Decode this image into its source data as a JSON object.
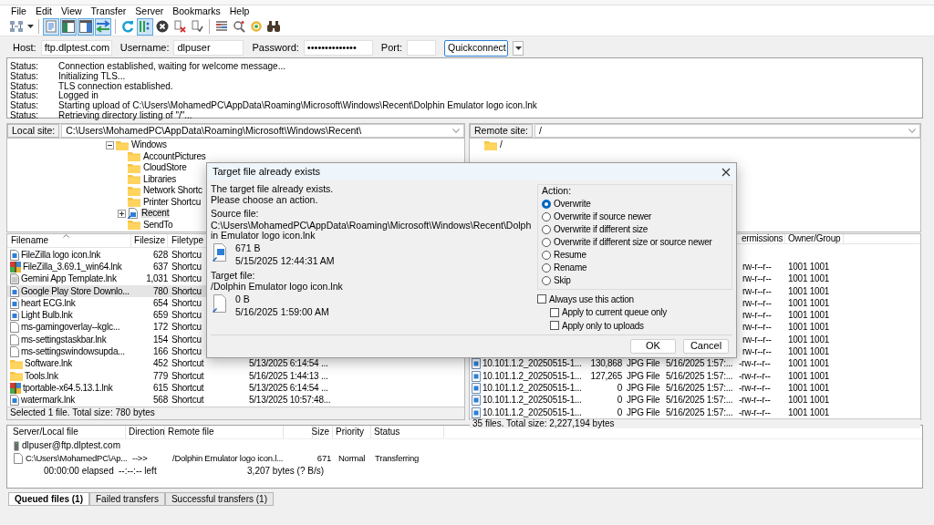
{
  "menu": [
    "File",
    "Edit",
    "View",
    "Transfer",
    "Server",
    "Bookmarks",
    "Help"
  ],
  "toolbar": [
    {
      "kind": "site-manager",
      "pressed": false
    },
    {
      "kind": "dropdown",
      "pressed": false
    },
    {
      "kind": "separator"
    },
    {
      "kind": "log",
      "pressed": true
    },
    {
      "kind": "local-tree",
      "pressed": true
    },
    {
      "kind": "remote-tree",
      "pressed": true
    },
    {
      "kind": "queue",
      "pressed": true
    },
    {
      "kind": "separator"
    },
    {
      "kind": "refresh",
      "pressed": false
    },
    {
      "kind": "process-queue",
      "pressed": true
    },
    {
      "kind": "cancel",
      "pressed": false
    },
    {
      "kind": "disconnect",
      "pressed": false
    },
    {
      "kind": "reconnect",
      "pressed": false
    },
    {
      "kind": "separator"
    },
    {
      "kind": "filter",
      "pressed": false
    },
    {
      "kind": "compare",
      "pressed": false
    },
    {
      "kind": "sync",
      "pressed": false
    },
    {
      "kind": "search",
      "pressed": false
    }
  ],
  "quickconnect": {
    "fields": [
      {
        "label": "Host:",
        "value": "ftp.dlptest.com"
      },
      {
        "label": "Username:",
        "value": "dlpuser"
      },
      {
        "label": "Password:",
        "value": "••••••••••••••"
      },
      {
        "label": "Port:"
      }
    ],
    "button": "Quickconnect"
  },
  "log": [
    {
      "type": "Status:",
      "text": "Connection established, waiting for welcome message..."
    },
    {
      "type": "Status:",
      "text": "Initializing TLS..."
    },
    {
      "type": "Status:",
      "text": "TLS connection established."
    },
    {
      "type": "Status:",
      "text": "Logged in"
    },
    {
      "type": "Status:",
      "text": "Starting upload of C:\\Users\\MohamedPC\\AppData\\Roaming\\Microsoft\\Windows\\Recent\\Dolphin Emulator logo icon.lnk"
    },
    {
      "type": "Status:",
      "text": "Retrieving directory listing of \"/\"..."
    }
  ],
  "local_site": {
    "label": "Local site:",
    "path": "C:\\Users\\MohamedPC\\AppData\\Roaming\\Microsoft\\Windows\\Recent\\"
  },
  "local_tree": [
    {
      "label": "Windows",
      "kind": "folder",
      "expanded": true,
      "selected": false,
      "children": [
        {
          "label": "AccountPictures",
          "kind": "folder",
          "selected": false
        },
        {
          "label": "CloudStore",
          "kind": "folder",
          "selected": false
        },
        {
          "label": "Libraries",
          "kind": "folder",
          "selected": false
        },
        {
          "label": "Network Shortc",
          "kind": "folder",
          "selected": false
        },
        {
          "label": "Printer Shortcu",
          "kind": "folder",
          "selected": false
        },
        {
          "label": "Recent",
          "kind": "shortcut",
          "expanded": false,
          "selected": true
        },
        {
          "label": "SendTo",
          "kind": "folder",
          "selected": false
        }
      ]
    }
  ],
  "local_files": {
    "columns": [
      "Filename",
      "Filesize",
      "Filetype"
    ],
    "rows": [
      {
        "kind": "link",
        "name": "FileZilla logo icon.lnk",
        "size": "628",
        "type": "Shortcu",
        "selected": false
      },
      {
        "kind": "archive",
        "name": "FileZilla_3.69.1_win64.lnk",
        "size": "637",
        "type": "Shortcu",
        "selected": false
      },
      {
        "kind": "file",
        "name": "Gemini App Template.lnk",
        "size": "1,031",
        "type": "Shortcu",
        "selected": false
      },
      {
        "kind": "link",
        "name": "Google Play Store Downlo...",
        "size": "780",
        "type": "Shortcu",
        "selected": true
      },
      {
        "kind": "link",
        "name": "heart ECG.lnk",
        "size": "654",
        "type": "Shortcu",
        "selected": false
      },
      {
        "kind": "link",
        "name": "Light Bulb.lnk",
        "size": "659",
        "type": "Shortcu",
        "selected": false
      },
      {
        "kind": "blank",
        "name": "ms-gamingoverlay--kglc...",
        "size": "172",
        "type": "Shortcu",
        "selected": false
      },
      {
        "kind": "blank",
        "name": "ms-settingstaskbar.lnk",
        "size": "154",
        "type": "Shortcu",
        "selected": false
      },
      {
        "kind": "blank",
        "name": "ms-settingswindowsupda...",
        "size": "166",
        "type": "Shortcu",
        "selected": false
      },
      {
        "kind": "folder",
        "name": "Software.lnk",
        "size": "452",
        "type": "Shortcut",
        "modified": "5/13/2025 6:14:54 ...",
        "selected": false
      },
      {
        "kind": "folder",
        "name": "Tools.lnk",
        "size": "779",
        "type": "Shortcut",
        "modified": "5/16/2025 1:44:13 ...",
        "selected": false
      },
      {
        "kind": "archive",
        "name": "tportable-x64.5.13.1.lnk",
        "size": "615",
        "type": "Shortcut",
        "modified": "5/13/2025 6:14:54 ...",
        "selected": false
      },
      {
        "kind": "link",
        "name": "watermark.lnk",
        "size": "568",
        "type": "Shortcut",
        "modified": "5/13/2025 10:57:48...",
        "selected": false
      }
    ]
  },
  "local_status": "Selected 1 file. Total size: 780 bytes",
  "remote_site": {
    "label": "Remote site:",
    "path": "/"
  },
  "remote_tree": [
    {
      "label": "/",
      "kind": "folder",
      "selected": false
    }
  ],
  "remote_files": {
    "columns": [
      "ermissions",
      "Owner/Group"
    ],
    "rows": [
      {
        "permissions": "rw-r--r--",
        "owner": "1001 1001",
        "selected": false
      },
      {
        "permissions": "rw-r--r--",
        "owner": "1001 1001",
        "selected": false
      },
      {
        "permissions": "rw-r--r--",
        "owner": "1001 1001",
        "selected": false
      },
      {
        "permissions": "rw-r--r--",
        "owner": "1001 1001",
        "selected": false
      },
      {
        "permissions": "rw-r--r--",
        "owner": "1001 1001",
        "selected": false
      },
      {
        "permissions": "rw-r--r--",
        "owner": "1001 1001",
        "selected": false
      },
      {
        "permissions": "rw-r--r--",
        "owner": "1001 1001",
        "selected": false
      },
      {
        "permissions": "rw-r--r--",
        "owner": "1001 1001",
        "selected": false
      },
      {
        "kind": "image",
        "name": "10.101.1.2_20250515-1...",
        "size": "130,868",
        "type": "JPG File",
        "modified": "5/16/2025 1:57:...",
        "permissions": "-rw-r--r--",
        "owner": "1001 1001",
        "selected": false
      },
      {
        "kind": "image",
        "name": "10.101.1.2_20250515-1...",
        "size": "127,265",
        "type": "JPG File",
        "modified": "5/16/2025 1:57:...",
        "permissions": "-rw-r--r--",
        "owner": "1001 1001",
        "selected": false
      },
      {
        "kind": "image",
        "name": "10.101.1.2_20250515-1...",
        "size": "0",
        "type": "JPG File",
        "modified": "5/16/2025 1:57:...",
        "permissions": "-rw-r--r--",
        "owner": "1001 1001",
        "selected": false
      },
      {
        "kind": "image",
        "name": "10.101.1.2_20250515-1...",
        "size": "0",
        "type": "JPG File",
        "modified": "5/16/2025 1:57:...",
        "permissions": "-rw-r--r--",
        "owner": "1001 1001",
        "selected": false
      },
      {
        "kind": "image",
        "name": "10.101.1.2_20250515-1...",
        "size": "0",
        "type": "JPG File",
        "modified": "5/16/2025 1:57:...",
        "permissions": "-rw-r--r--",
        "owner": "1001 1001",
        "selected": false
      }
    ]
  },
  "remote_status": "35 files. Total size: 2,227,194 bytes",
  "dialog": {
    "title": "Target file already exists",
    "message": [
      "The target file already exists.",
      "Please choose an action."
    ],
    "source": {
      "label": "Source file:",
      "path": "C:\\Users\\MohamedPC\\AppData\\Roaming\\Microsoft\\Windows\\Recent\\Dolphin Emulator logo icon.lnk",
      "size": "671 B",
      "date": "5/15/2025 12:44:31 AM",
      "kind": "image"
    },
    "target": {
      "label": "Target file:",
      "path": "/Dolphin Emulator logo icon.lnk",
      "size": "0 B",
      "date": "5/16/2025 1:59:00 AM",
      "kind": "blank"
    },
    "action_label": "Action:",
    "actions": [
      {
        "label": "Overwrite",
        "selected": true
      },
      {
        "label": "Overwrite if source newer",
        "selected": false
      },
      {
        "label": "Overwrite if different size",
        "selected": false
      },
      {
        "label": "Overwrite if different size or source newer",
        "selected": false
      },
      {
        "label": "Resume",
        "selected": false
      },
      {
        "label": "Rename",
        "selected": false
      },
      {
        "label": "Skip",
        "selected": false
      }
    ],
    "options": [
      {
        "label": "Always use this action",
        "checked": false,
        "children": [
          {
            "label": "Apply to current queue only",
            "checked": false
          },
          {
            "label": "Apply only to uploads",
            "checked": false
          }
        ]
      }
    ],
    "buttons": [
      "OK",
      "Cancel"
    ]
  },
  "queue": {
    "columns": [
      "Server/Local file",
      "Direction",
      "Remote file",
      "Size",
      "Priority",
      "Status"
    ],
    "server": "dlpuser@ftp.dlptest.com",
    "transfers": [
      {
        "local": "C:\\Users\\MohamedPC\\Ap...",
        "direction": "-->>",
        "remote": "/Dolphin Emulator logo icon.l...",
        "size": "671",
        "priority": "Normal",
        "status": "Transferring",
        "elapsed": "00:00:00 elapsed",
        "left": "--:--:-- left",
        "progress": "3,207 bytes (? B/s)"
      }
    ]
  },
  "queue_tabs": [
    {
      "label": "Queued files (1)",
      "selected": true
    },
    {
      "label": "Failed transfers",
      "selected": false
    },
    {
      "label": "Successful transfers (1)",
      "selected": false
    }
  ]
}
